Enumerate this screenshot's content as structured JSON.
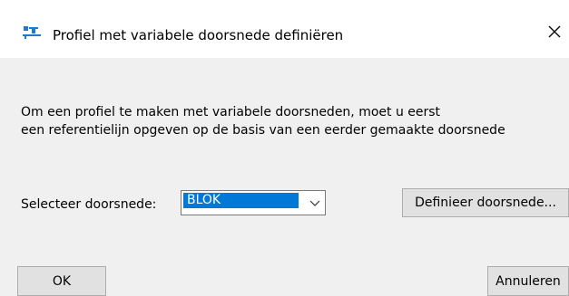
{
  "window": {
    "title": "Profiel met variabele doorsnede definiëren",
    "close_glyph": "✕",
    "icon": "profile-app-icon"
  },
  "message": {
    "line1": "Om een profiel te maken met variabele doorsneden, moet u eerst",
    "line2": "een referentielijn opgeven op de basis van een eerder gemaakte doorsnede"
  },
  "section": {
    "label": "Selecteer doorsnede:",
    "selected": "BLOK",
    "define_button": "Definieer doorsnede..."
  },
  "footer": {
    "ok_button": "OK",
    "cancel_button": "Annuleren"
  },
  "colors": {
    "selection": "#0078d7",
    "dialog_bg": "#f0f0f0",
    "titlebar_bg": "#ffffff",
    "button_bg": "#e1e1e1"
  }
}
